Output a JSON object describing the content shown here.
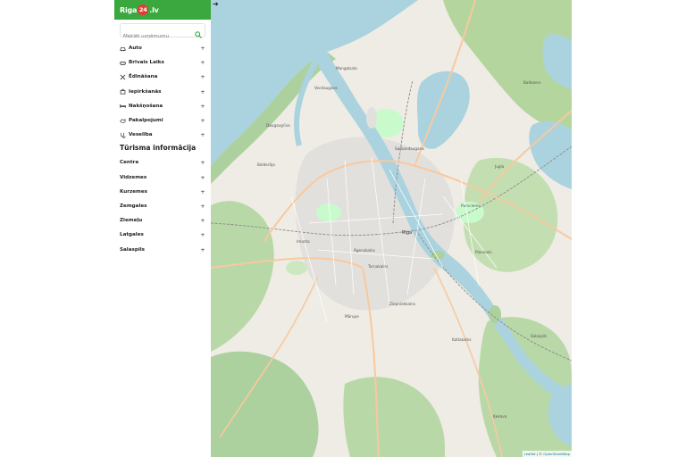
{
  "logo": {
    "prefix": "Riga",
    "badge": "24",
    "suffix": ".lv"
  },
  "search": {
    "placeholder": "Meklēt uzņēmumu",
    "value": ""
  },
  "categories": [
    {
      "label": "Auto",
      "icon": "car-icon"
    },
    {
      "label": "Brīvais Laiks",
      "icon": "leisure-icon"
    },
    {
      "label": "Ēdināšana",
      "icon": "dining-icon"
    },
    {
      "label": "Iepirkšanās",
      "icon": "shopping-icon"
    },
    {
      "label": "Nakšņošana",
      "icon": "bed-icon"
    },
    {
      "label": "Pakalpojumi",
      "icon": "services-icon"
    },
    {
      "label": "Veselība",
      "icon": "health-icon"
    }
  ],
  "tourism_title": "Tūrisma informācija",
  "regions": [
    {
      "label": "Centra"
    },
    {
      "label": "Vidzemes"
    },
    {
      "label": "Kurzemes"
    },
    {
      "label": "Zemgales"
    },
    {
      "label": "Ziemeļu"
    },
    {
      "label": "Latgales"
    },
    {
      "label": "Salaspils"
    }
  ],
  "expand_symbol": "➔",
  "plus_symbol": "+",
  "attribution": {
    "leaflet": "Leaflet",
    "separator": " | © ",
    "osm": "OpenStreetMap"
  },
  "map_labels": {
    "center": "Rīga",
    "mangalsala": "Mangaļsala",
    "vecdaugava": "Vecdaugava",
    "daugavgriva": "Daugavgrīva",
    "bolderaja": "Bolderāja",
    "sarkandaugava": "Sarkandaugava",
    "jugla": "Jugla",
    "purvciems": "Purvciems",
    "plavnieki": "Pļavnieki",
    "imanta": "Imanta",
    "agenskalns": "Āgenskalns",
    "marupe": "Mārupe",
    "katlakalns": "Katlakalns",
    "baltezers": "Baltezers",
    "kekava": "Ķekava",
    "salaspils": "Salaspils",
    "ziepniekkalns": "Ziepniekkalns",
    "tornakalns": "Torņakalns"
  },
  "colors": {
    "brand": "#3aa83e",
    "badge": "#e53935",
    "water": "#aad3df",
    "forest": "#add19e",
    "park": "#c8facc",
    "urban": "#e0dfdf",
    "road_major": "#f8c9a0",
    "road_minor": "#ffffff",
    "rail": "#8a8a8a"
  }
}
